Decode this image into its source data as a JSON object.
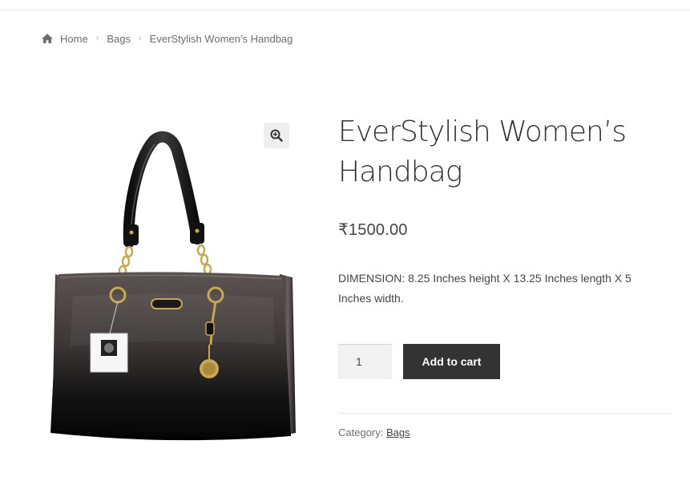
{
  "breadcrumb": {
    "home": "Home",
    "category": "Bags",
    "current": "EverStylish Women’s Handbag"
  },
  "product": {
    "title": "EverStylish Women’s Handbag",
    "price": "₹1500.00",
    "description": "DIMENSION: 8.25 Inches height X 13.25 Inches length X 5 Inches width.",
    "quantity": "1",
    "add_to_cart": "Add to cart",
    "category_label": "Category:",
    "category_value": "Bags"
  },
  "colors": {
    "button": "#333333",
    "qty_bg": "#f2f2f2"
  },
  "icons": {
    "home": "home-icon",
    "zoom": "zoom-icon"
  }
}
